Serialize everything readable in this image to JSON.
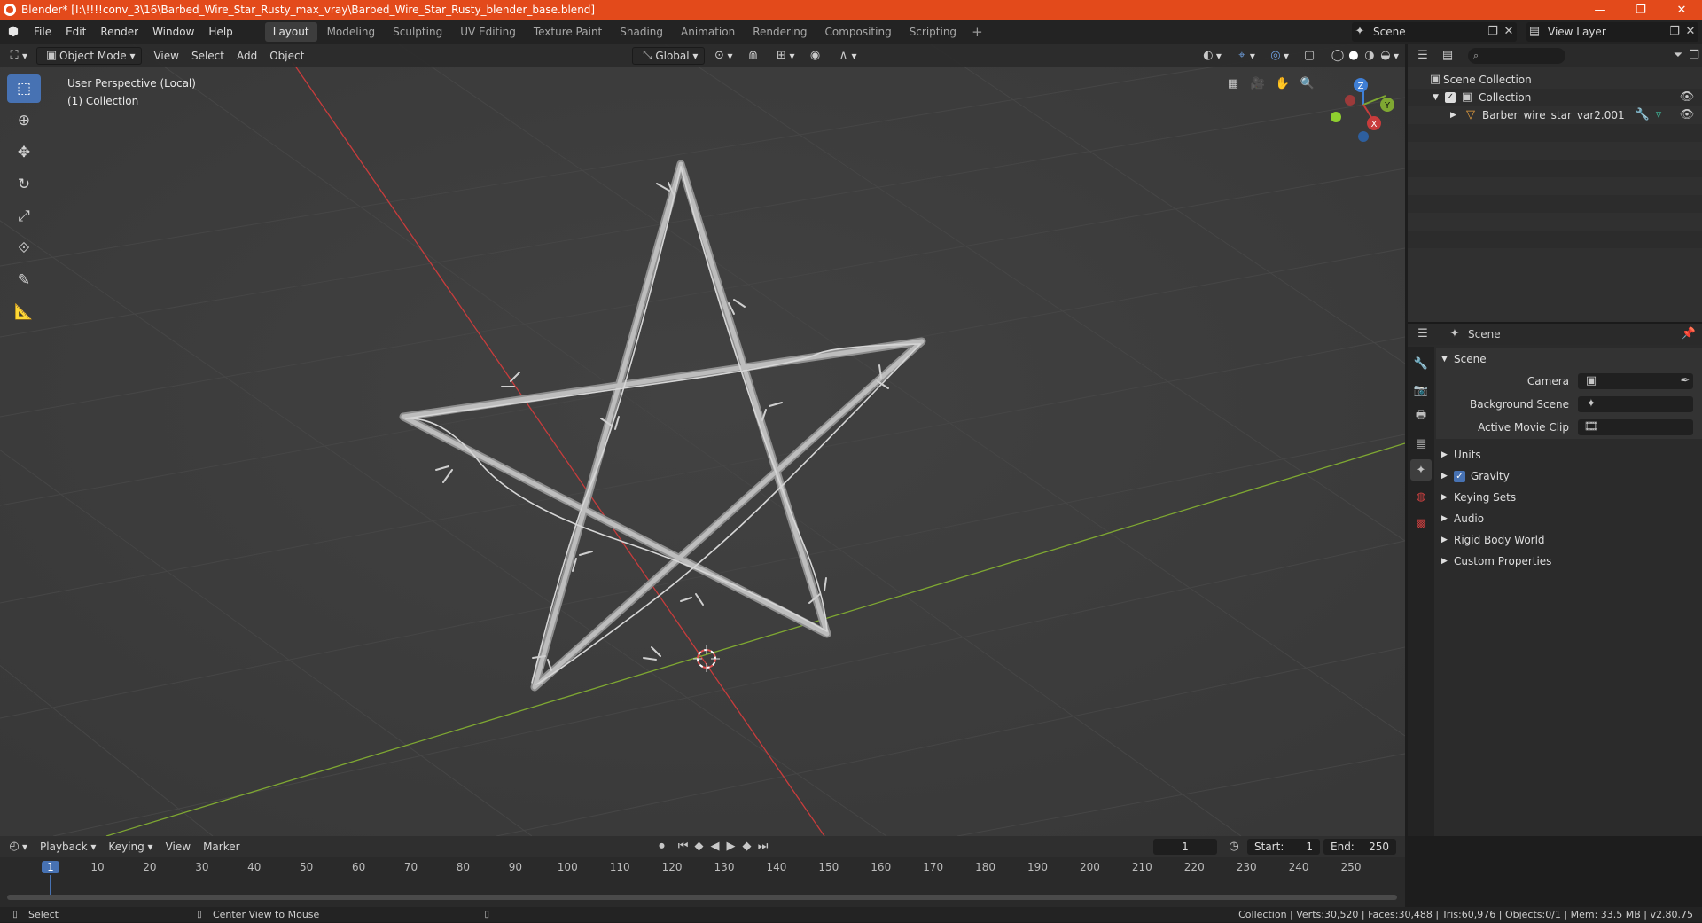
{
  "window": {
    "title": "Blender* [I:\\!!!!conv_3\\16\\Barbed_Wire_Star_Rusty_max_vray\\Barbed_Wire_Star_Rusty_blender_base.blend]",
    "minimize": "—",
    "maximize": "❐",
    "close": "✕"
  },
  "menu": [
    "File",
    "Edit",
    "Render",
    "Window",
    "Help"
  ],
  "workspaces": [
    "Layout",
    "Modeling",
    "Sculpting",
    "UV Editing",
    "Texture Paint",
    "Shading",
    "Animation",
    "Rendering",
    "Compositing",
    "Scripting"
  ],
  "active_workspace": "Layout",
  "scene_name": "Scene",
  "view_layer": "View Layer",
  "viewport": {
    "mode": "Object Mode",
    "menus": [
      "View",
      "Select",
      "Add",
      "Object"
    ],
    "orientation": "Global",
    "info_line1": "User Perspective (Local)",
    "info_line2": "(1) Collection",
    "gizmo": {
      "z": "Z",
      "y": "Y",
      "x": "X"
    }
  },
  "outliner": {
    "root": "Scene Collection",
    "collection": "Collection",
    "object": "Barber_wire_star_var2.001"
  },
  "properties": {
    "header": "Scene",
    "panel": "Scene",
    "camera_label": "Camera",
    "background_scene_label": "Background Scene",
    "active_movie_clip_label": "Active Movie Clip",
    "sections": [
      "Units",
      "Gravity",
      "Keying Sets",
      "Audio",
      "Rigid Body World",
      "Custom Properties"
    ]
  },
  "timeline": {
    "menus": [
      "Playback",
      "Keying",
      "View",
      "Marker"
    ],
    "current_frame": "1",
    "start_label": "Start:",
    "start": "1",
    "end_label": "End:",
    "end": "250",
    "ruler": [
      "1",
      "10",
      "20",
      "30",
      "40",
      "50",
      "60",
      "70",
      "80",
      "90",
      "100",
      "110",
      "120",
      "130",
      "140",
      "150",
      "160",
      "170",
      "180",
      "190",
      "200",
      "210",
      "220",
      "230",
      "240",
      "250"
    ]
  },
  "status": {
    "select": "Select",
    "center": "Center View to Mouse",
    "stats": "Collection | Verts:30,520 | Faces:30,488 | Tris:60,976 | Objects:0/1 | Mem: 33.5 MB | v2.80.75"
  },
  "colors": {
    "accent": "#4772b3",
    "title_bar": "#e34a1b",
    "x_axis": "#c83c3c",
    "y_axis": "#7fa832",
    "z_axis": "#3f7fd6"
  }
}
